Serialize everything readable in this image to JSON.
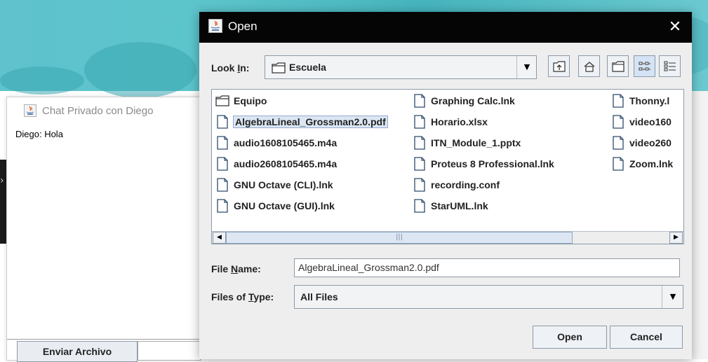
{
  "chat": {
    "title": "Chat Privado con Diego",
    "message": "Diego: Hola",
    "send_file_button": "Enviar Archivo"
  },
  "dialog": {
    "title": "Open",
    "look_in_label_prefix": "Look ",
    "look_in_label_mnemonic": "I",
    "look_in_label_suffix": "n:",
    "look_in_value": "Escuela",
    "file_name_label_prefix": "File ",
    "file_name_label_mnemonic": "N",
    "file_name_label_suffix": "ame:",
    "file_name_value": "AlgebraLineal_Grossman2.0.pdf",
    "file_type_label_prefix": "Files of ",
    "file_type_label_mnemonic": "T",
    "file_type_label_suffix": "ype:",
    "file_type_value": "All Files",
    "open_button": "Open",
    "cancel_button": "Cancel"
  },
  "files": {
    "col1": [
      {
        "name": "Equipo",
        "icon": "folder-icon"
      },
      {
        "name": "AlgebraLineal_Grossman2.0.pdf",
        "icon": "file-icon",
        "selected": true
      },
      {
        "name": "audio1608105465.m4a",
        "icon": "file-icon"
      },
      {
        "name": "audio2608105465.m4a",
        "icon": "file-icon"
      },
      {
        "name": "GNU Octave (CLI).lnk",
        "icon": "file-icon"
      },
      {
        "name": "GNU Octave (GUI).lnk",
        "icon": "file-icon"
      }
    ],
    "col2": [
      {
        "name": "Graphing Calc.lnk",
        "icon": "file-icon"
      },
      {
        "name": "Horario.xlsx",
        "icon": "file-icon"
      },
      {
        "name": "ITN_Module_1.pptx",
        "icon": "file-icon"
      },
      {
        "name": "Proteus 8 Professional.lnk",
        "icon": "file-icon"
      },
      {
        "name": "recording.conf",
        "icon": "file-icon"
      },
      {
        "name": "StarUML.lnk",
        "icon": "file-icon"
      }
    ],
    "col3": [
      {
        "name": "Thonny.l",
        "icon": "file-icon"
      },
      {
        "name": "video160",
        "icon": "file-icon"
      },
      {
        "name": "video260",
        "icon": "file-icon"
      },
      {
        "name": "Zoom.lnk",
        "icon": "file-icon"
      }
    ]
  }
}
